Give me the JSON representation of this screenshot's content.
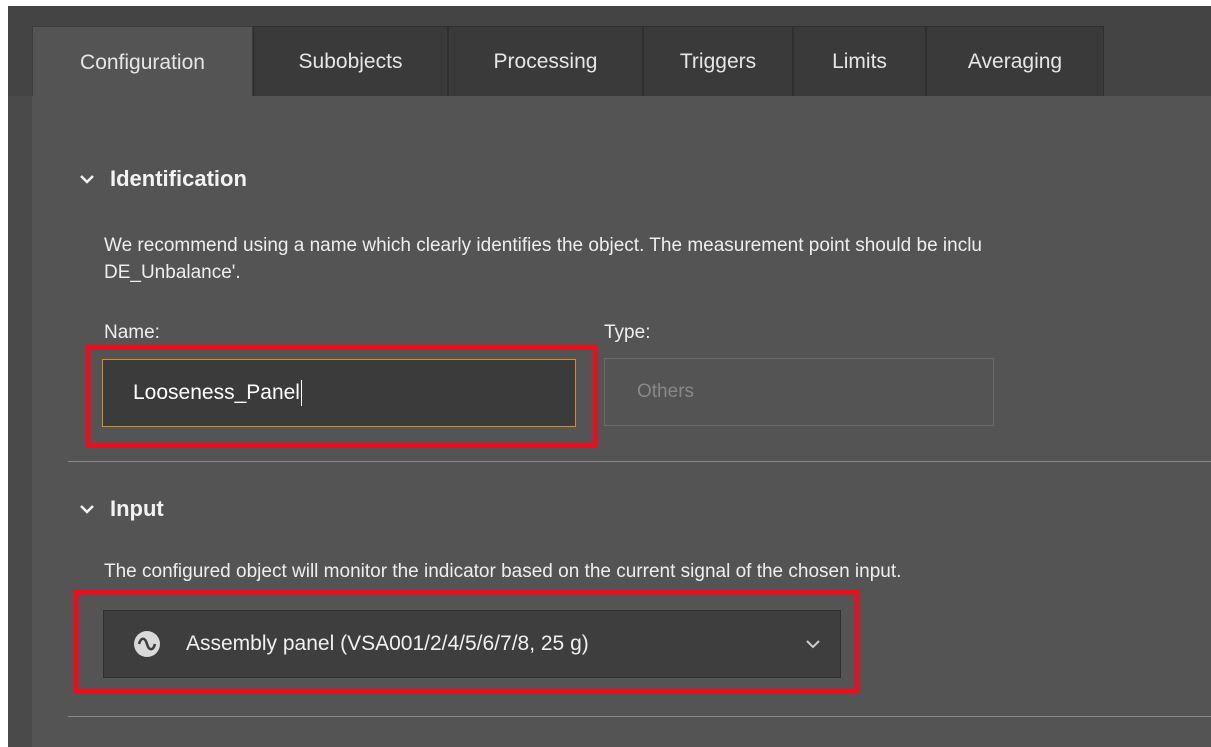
{
  "tabs": [
    {
      "label": "Configuration"
    },
    {
      "label": "Subobjects"
    },
    {
      "label": "Processing"
    },
    {
      "label": "Triggers"
    },
    {
      "label": "Limits"
    },
    {
      "label": "Averaging"
    }
  ],
  "identification": {
    "heading": "Identification",
    "description_line1": "We recommend using a name which clearly identifies the object. The measurement point should be inclu",
    "description_line2": "DE_Unbalance'.",
    "name_label": "Name:",
    "name_value": "Looseness_Panel",
    "type_label": "Type:",
    "type_value": "Others"
  },
  "input": {
    "heading": "Input",
    "description": "The configured object will monitor the indicator based on the current signal of the chosen input.",
    "selected_value": "Assembly panel (VSA001/2/4/5/6/7/8, 25 g)",
    "icon": "signal-wave-icon"
  },
  "colors": {
    "highlight": "#e8101e",
    "focus_border": "#d4901f",
    "background": "#545454"
  }
}
